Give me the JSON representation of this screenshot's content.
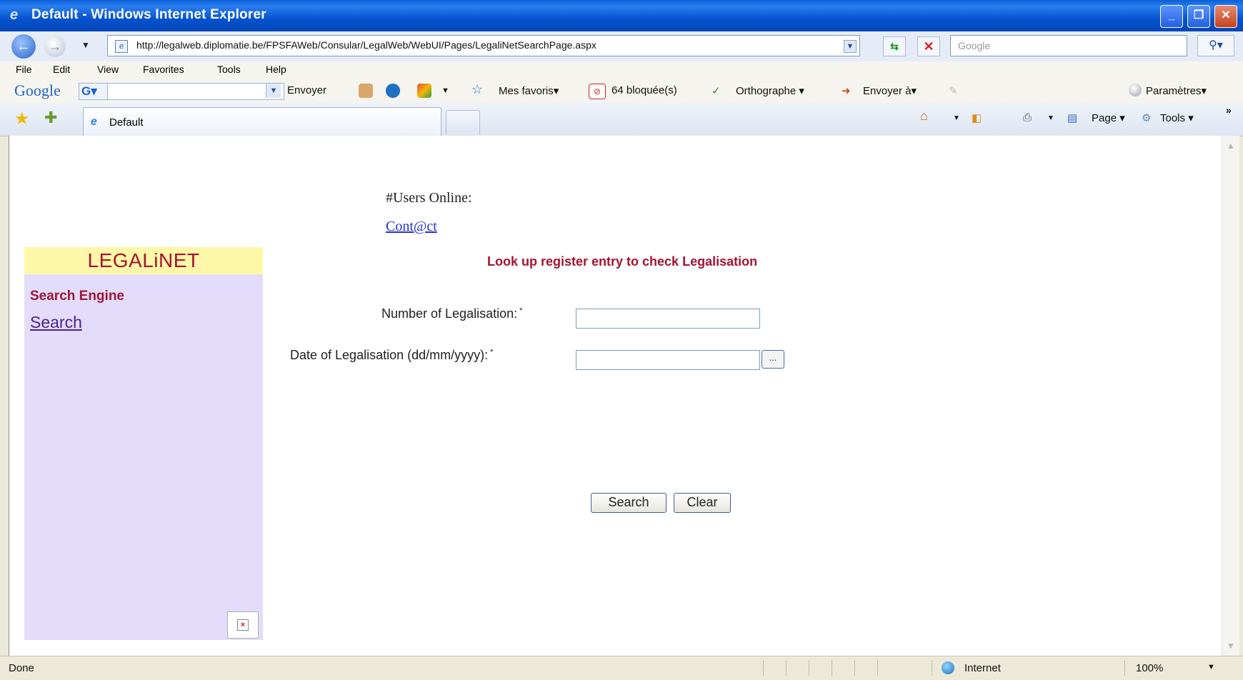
{
  "window": {
    "title": "Default - Windows Internet Explorer"
  },
  "address_bar": {
    "url": "http://legalweb.diplomatie.be/FPSFAWeb/Consular/LegalWeb/WebUI/Pages/LegaliNetSearchPage.aspx",
    "search_placeholder": "Google"
  },
  "menu": [
    "File",
    "Edit",
    "View",
    "Favorites",
    "Tools",
    "Help"
  ],
  "google_toolbar": {
    "logo": "Google",
    "g_button": "G",
    "send": "Envoyer",
    "favorites": "Mes favoris",
    "blocked": "64 bloquée(s)",
    "spelling": "Orthographe",
    "send_to": "Envoyer à",
    "settings": "Paramètres"
  },
  "tabs": [
    {
      "label": "Default"
    }
  ],
  "command_bar": {
    "page": "Page",
    "tools": "Tools"
  },
  "sidebar": {
    "title": "LEGALiNET",
    "section": "Search Engine",
    "link": "Search"
  },
  "main": {
    "users_online": "#Users Online:",
    "contact_link": "Cont@ct",
    "heading": "Look up register entry to check Legalisation",
    "fields": {
      "number_label": "Number of Legalisation:",
      "date_label": "Date of Legalisation (dd/mm/yyyy):",
      "required_marker": "*",
      "number_value": "",
      "date_value": "",
      "calendar_button": "..."
    },
    "buttons": {
      "search": "Search",
      "clear": "Clear"
    }
  },
  "status_bar": {
    "status": "Done",
    "zone": "Internet",
    "zoom": "100%"
  },
  "colors": {
    "sidebar_bg": "#e3dcfb",
    "sidebar_header_bg": "#fff7a8",
    "accent_red": "#a31432",
    "link_purple": "#4b238f",
    "link_blue": "#2730c8"
  }
}
